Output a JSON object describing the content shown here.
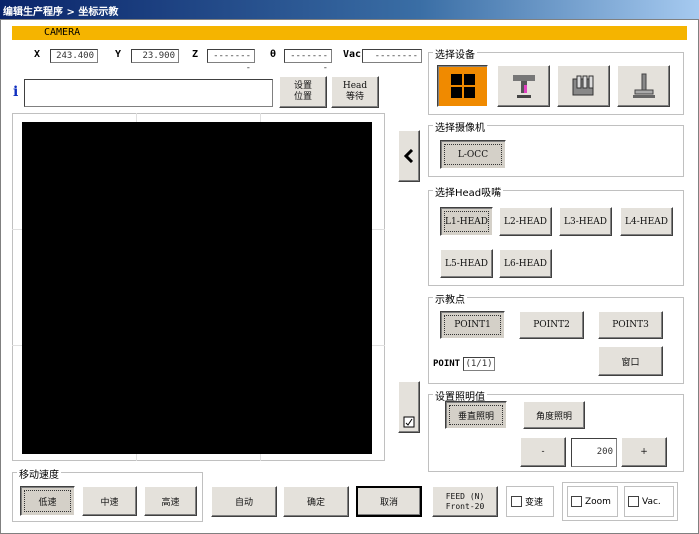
{
  "window": {
    "title": "编辑生产程序 > 坐标示教"
  },
  "camera_bar": {
    "label": "CAMERA"
  },
  "coords": {
    "x_label": "X",
    "x_value": "243.400",
    "y_label": "Y",
    "y_value": "23.900",
    "z_label": "Z",
    "z_value": "--------",
    "theta_label": "θ",
    "theta_value": "--------",
    "vac_label": "Vac",
    "vac_value": "--------"
  },
  "info": {
    "icon_char": "i",
    "value": ""
  },
  "buttons": {
    "set_position": "设置\n位置",
    "head_wait": "Head\n等待"
  },
  "select_device": {
    "title": "选择设备"
  },
  "select_camera": {
    "title": "选择摄像机",
    "camera_button": "L-OCC"
  },
  "select_head": {
    "title": "选择Head吸嘴",
    "heads": [
      "L1-HEAD",
      "L2-HEAD",
      "L3-HEAD",
      "L4-HEAD",
      "L5-HEAD",
      "L6-HEAD"
    ]
  },
  "teach_points": {
    "title": "示教点",
    "points": [
      "POINT1",
      "POINT2",
      "POINT3"
    ],
    "point_label": "POINT",
    "point_value": "(1/1)",
    "window_button": "窗口"
  },
  "lighting": {
    "title": "设置照明值",
    "vertical": "垂直照明",
    "angle": "角度照明",
    "minus": "-",
    "value": "200",
    "plus": "+"
  },
  "move_speed": {
    "title": "移动速度",
    "low": "低速",
    "mid": "中速",
    "high": "高速"
  },
  "bottom": {
    "auto": "自动",
    "confirm": "确定",
    "cancel": "取消",
    "feed_line1": "FEED (N)",
    "feed_line2": "Front-20",
    "transform": "变速",
    "zoom": "Zoom",
    "vac": "Vac."
  },
  "colors": {
    "title_bar": "#0a246a",
    "camera_bar": "#f5b400",
    "selected_device": "#f08a00",
    "camera_view": "#000000",
    "face": "#e4e1db"
  }
}
